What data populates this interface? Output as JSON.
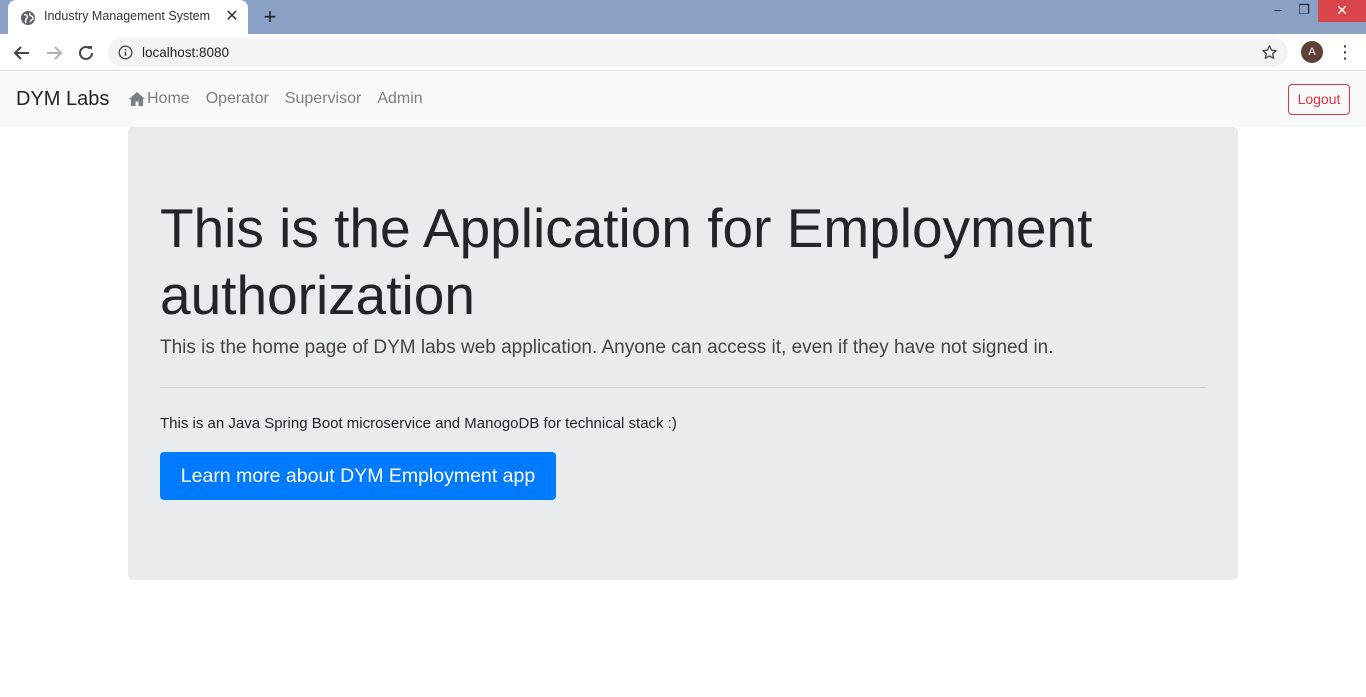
{
  "browser": {
    "tab_title": "Industry Management System",
    "tab_close": "✕",
    "new_tab": "+",
    "url": "localhost:8080",
    "profile_initial": "A",
    "menu": "⋮",
    "window_controls": {
      "minimize": "–",
      "maximize": "❐",
      "close": "✕"
    }
  },
  "navbar": {
    "brand": "DYM Labs",
    "links": [
      "Home",
      "Operator",
      "Supervisor",
      "Admin"
    ],
    "logout_label": "Logout"
  },
  "jumbotron": {
    "title": "This is the Application for Employment authorization",
    "lead": "This is the home page of DYM labs web application. Anyone can access it, even if they have not signed in.",
    "stack_text": "This is an Java Spring Boot microservice and ManogoDB for technical stack :)",
    "button_label": "Learn more about DYM Employment app"
  },
  "colors": {
    "primary": "#007bff",
    "danger": "#dc3545",
    "jumbotron_bg": "#e9ecef",
    "navbar_bg": "#f8f9fa",
    "tabstrip_bg": "#8aa0c4"
  }
}
